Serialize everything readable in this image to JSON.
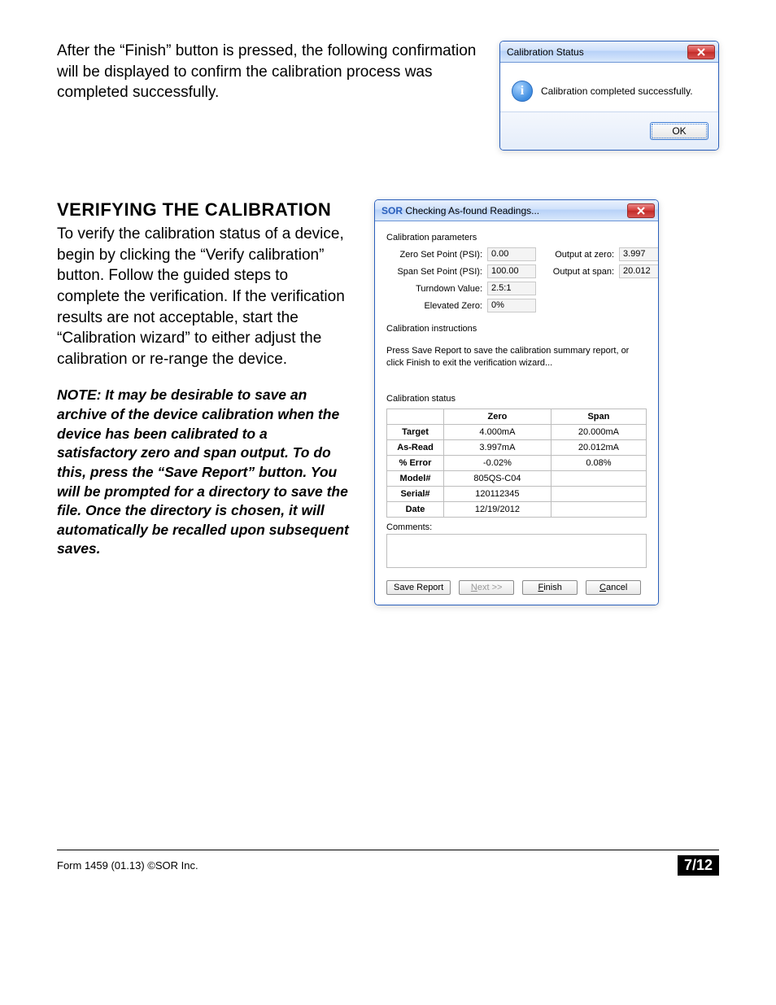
{
  "top_paragraph": "After the “Finish” button is pressed, the following confirmation will be displayed to confirm the calibration process was completed successfully.",
  "status_dialog": {
    "title": "Calibration Status",
    "message": "Calibration completed successfully.",
    "ok": "OK"
  },
  "section_heading": "VERIFYING THE CALIBRATION",
  "verify_paragraph": "To verify the calibration status of a device, begin by clicking the “Verify calibration” button. Follow the guided steps to complete the verification. If the verification results are not acceptable, start the “Calibration wizard” to either adjust the calibration or re-range the device.",
  "note_paragraph": "NOTE: It may be desirable to save an archive of the device calibration when the device has been calibrated to a satisfactory zero and span output. To do this, press the “Save Report” button. You will be prompted for a directory to save the file. Once the directory is chosen, it will automatically be recalled upon subsequent saves.",
  "wizard": {
    "title": "Checking As-found Readings...",
    "params_title": "Calibration parameters",
    "labels": {
      "zero_sp": "Zero Set Point (PSI):",
      "span_sp": "Span Set Point (PSI):",
      "turndown": "Turndown Value:",
      "elev_zero": "Elevated Zero:",
      "out_zero": "Output at zero:",
      "out_span": "Output at span:"
    },
    "values": {
      "zero_sp": "0.00",
      "span_sp": "100.00",
      "turndown": "2.5:1",
      "elev_zero": "0%",
      "out_zero": "3.997",
      "out_span": "20.012"
    },
    "instr_title": "Calibration instructions",
    "instr_text": "Press Save Report to save the calibration summary report, or click Finish to exit the verification wizard...",
    "status_title": "Calibration status",
    "table": {
      "col_zero": "Zero",
      "col_span": "Span",
      "rows": {
        "target": {
          "hdr": "Target",
          "zero": "4.000mA",
          "span": "20.000mA"
        },
        "asread": {
          "hdr": "As-Read",
          "zero": "3.997mA",
          "span": "20.012mA"
        },
        "error": {
          "hdr": "% Error",
          "zero": "-0.02%",
          "span": "0.08%"
        },
        "model": {
          "hdr": "Model#",
          "zero": "805QS-C04",
          "span": ""
        },
        "serial": {
          "hdr": "Serial#",
          "zero": "120112345",
          "span": ""
        },
        "date": {
          "hdr": "Date",
          "zero": "12/19/2012",
          "span": ""
        }
      }
    },
    "comments_label": "Comments:",
    "buttons": {
      "save": "Save Report",
      "next": "Next >>",
      "finish": "Finish",
      "cancel": "Cancel"
    }
  },
  "footer": {
    "left": "Form 1459 (01.13) ©SOR Inc.",
    "page": "7/12"
  }
}
